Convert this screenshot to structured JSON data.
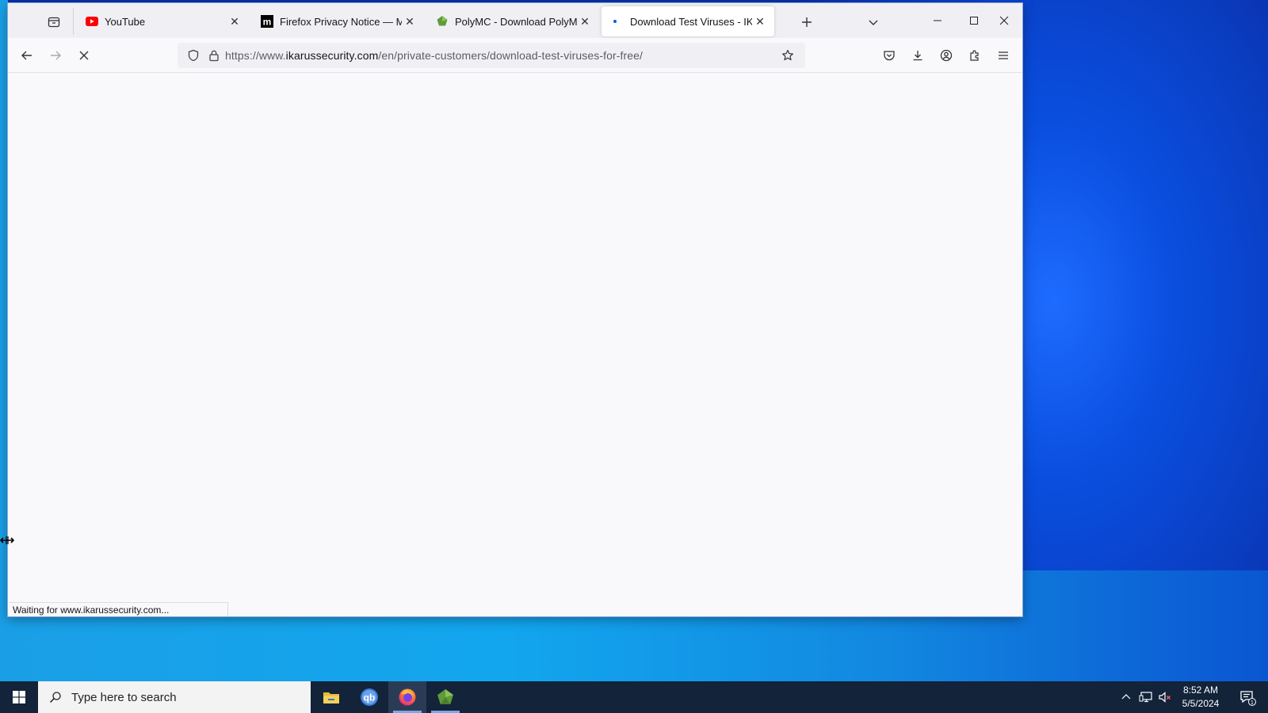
{
  "browser": {
    "tabs": [
      {
        "title": "YouTube",
        "favicon": "youtube-icon",
        "active": false
      },
      {
        "title": "Firefox Privacy Notice — Mozilla",
        "favicon": "mozilla-m-icon",
        "active": false
      },
      {
        "title": "PolyMC - Download PolyMC for",
        "favicon": "polymc-icon",
        "active": false
      },
      {
        "title": "Download Test Viruses - IKARUS",
        "favicon": "loading-dot-icon",
        "active": true
      }
    ],
    "url": {
      "prefix": "https://www.",
      "host": "ikarussecurity.com",
      "path": "/en/private-customers/download-test-viruses-for-free/"
    },
    "status_text": "Waiting for www.ikarussecurity.com...",
    "page_loading": true
  },
  "taskbar": {
    "search_placeholder": "Type here to search",
    "time": "8:52 AM",
    "date": "5/5/2024",
    "notification_count": "1",
    "apps": [
      "file-explorer-icon",
      "qbittorrent-icon",
      "firefox-icon",
      "polymc-icon"
    ]
  },
  "colors": {
    "youtube_red": "#ff0000",
    "firefox_blue": "#0060df",
    "taskbar": "#12233a",
    "desktop_blue": "#0a3fc4"
  }
}
